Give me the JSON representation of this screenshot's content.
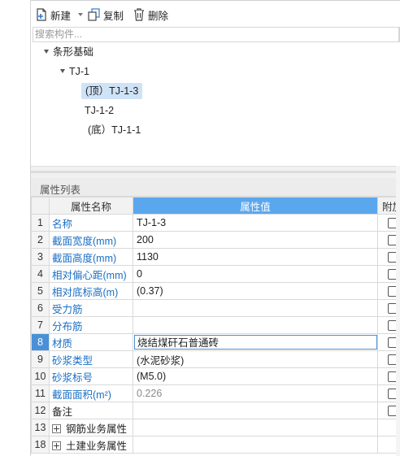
{
  "toolbar": {
    "new_label": "新建",
    "copy_label": "复制",
    "delete_label": "删除"
  },
  "search": {
    "placeholder": "搜索构件..."
  },
  "tree": {
    "root": "条形基础",
    "group": "TJ-1",
    "items": [
      "(顶）TJ-1-3",
      "TJ-1-2",
      "(底）TJ-1-1"
    ]
  },
  "properties": {
    "title": "属性列表",
    "col_name": "属性名称",
    "col_value": "属性值",
    "col_extra": "附加",
    "rows": [
      {
        "num": "1",
        "name": "名称",
        "value": "TJ-1-3"
      },
      {
        "num": "2",
        "name": "截面宽度(mm)",
        "value": "200"
      },
      {
        "num": "3",
        "name": "截面高度(mm)",
        "value": "1130"
      },
      {
        "num": "4",
        "name": "相对偏心距(mm)",
        "value": "0"
      },
      {
        "num": "5",
        "name": "相对底标高(m)",
        "value": "(0.37)"
      },
      {
        "num": "6",
        "name": "受力筋",
        "value": ""
      },
      {
        "num": "7",
        "name": "分布筋",
        "value": ""
      },
      {
        "num": "8",
        "name": "材质",
        "value": "烧结煤矸石普通砖"
      },
      {
        "num": "9",
        "name": "砂浆类型",
        "value": "(水泥砂浆)"
      },
      {
        "num": "10",
        "name": "砂浆标号",
        "value": "(M5.0)"
      },
      {
        "num": "11",
        "name": "截面面积(m²)",
        "value": "0.226"
      },
      {
        "num": "12",
        "name": "备注",
        "value": ""
      },
      {
        "num": "13",
        "name": "钢筋业务属性",
        "value": ""
      },
      {
        "num": "18",
        "name": "土建业务属性",
        "value": ""
      }
    ]
  },
  "colors": {
    "accent": "#5ba7ee",
    "link_blue": "#1a6fc4",
    "selection": "#cfe3f7"
  }
}
